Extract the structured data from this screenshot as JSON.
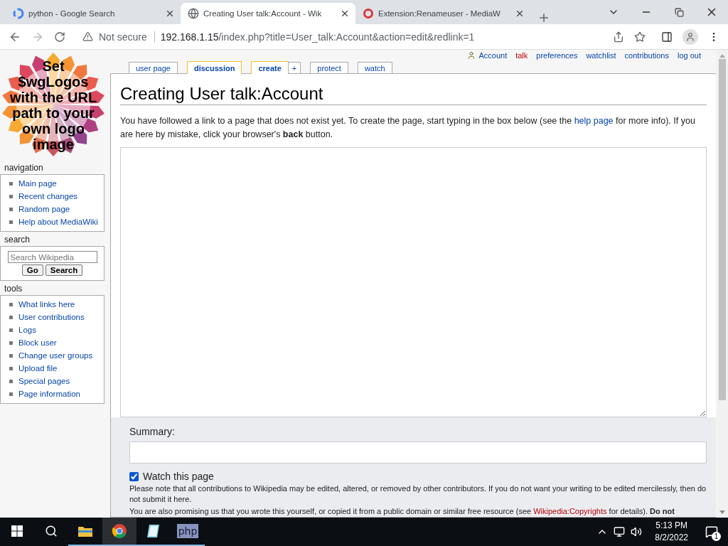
{
  "browser": {
    "tabs": [
      {
        "title": "python - Google Search",
        "selected": false,
        "kind": "google"
      },
      {
        "title": "Creating User talk:Account - Wik",
        "selected": true,
        "kind": "globe"
      },
      {
        "title": "Extension:Renameuser - MediaW",
        "selected": false,
        "kind": "ring"
      }
    ],
    "security": "Not secure",
    "url_host": "192.168.1.15",
    "url_path": "/index.php?title=User_talk:Account&action=edit&redlink=1"
  },
  "logo": {
    "lines": [
      "Set",
      "$wgLogos",
      "with the URL",
      "path to your",
      "own logo",
      "image"
    ]
  },
  "personal_tools": [
    {
      "label": "Account",
      "kind": "user",
      "redlink": false
    },
    {
      "label": "talk",
      "kind": "link",
      "redlink": true
    },
    {
      "label": "preferences",
      "kind": "link",
      "redlink": false
    },
    {
      "label": "watchlist",
      "kind": "link",
      "redlink": false
    },
    {
      "label": "contributions",
      "kind": "link",
      "redlink": false
    },
    {
      "label": "log out",
      "kind": "link",
      "redlink": false
    }
  ],
  "page_tabs": [
    {
      "label": "user page",
      "kind": "tab",
      "selected": false
    },
    {
      "label": "discussion",
      "kind": "tab",
      "selected": true
    },
    {
      "label": "create",
      "kind": "tab",
      "selected": true
    },
    {
      "label": "+",
      "kind": "attached",
      "selected": false
    },
    {
      "label": "protect",
      "kind": "tab",
      "selected": false
    },
    {
      "label": "watch",
      "kind": "tab",
      "selected": false
    }
  ],
  "sidebar": [
    {
      "title": "navigation",
      "kind": "links",
      "items": [
        "Main page",
        "Recent changes",
        "Random page",
        "Help about MediaWiki"
      ]
    },
    {
      "title": "search",
      "kind": "search",
      "placeholder": "Search Wikipedia",
      "buttons": [
        "Go",
        "Search"
      ]
    },
    {
      "title": "tools",
      "kind": "links",
      "items": [
        "What links here",
        "User contributions",
        "Logs",
        "Block user",
        "Change user groups",
        "Upload file",
        "Special pages",
        "Page information"
      ]
    }
  ],
  "heading": "Creating User talk:Account",
  "intro": [
    {
      "kind": "text",
      "text": "You have followed a link to a page that does not exist yet. To create the page, start typing in the box below (see the "
    },
    {
      "kind": "link",
      "text": "help page"
    },
    {
      "kind": "text",
      "text": " for more info). If you are here by mistake, click your browser's **back** button."
    }
  ],
  "summary_label": "Summary:",
  "watch": {
    "label": "Watch this page",
    "checked": true
  },
  "notices": [
    [
      {
        "kind": "text",
        "text": "Please note that all contributions to Wikipedia may be edited, altered, or removed by other contributors. If you do not want your writing to be edited mercilessly, then do not submit it here."
      }
    ],
    [
      {
        "kind": "text",
        "text": "You are also promising us that you wrote this yourself, or copied it from a public domain or similar free resource (see "
      },
      {
        "kind": "redlink",
        "text": "Wikipedia:Copyrights"
      },
      {
        "kind": "text",
        "text": " for details). **Do not**"
      }
    ]
  ],
  "taskbar": {
    "apps": [
      {
        "kind": "explorer",
        "active": false
      },
      {
        "kind": "chrome",
        "active": true
      },
      {
        "kind": "app",
        "active": false
      },
      {
        "kind": "php",
        "active": false,
        "label": "php"
      }
    ],
    "time": "5:13 PM",
    "date": "8/2/2022",
    "notifications": "1"
  }
}
